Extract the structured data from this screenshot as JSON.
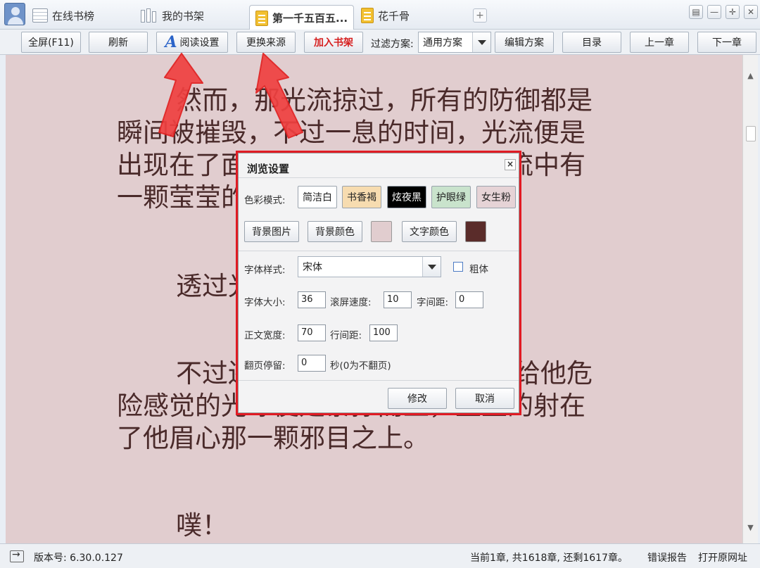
{
  "tabs": [
    {
      "label": "在线书榜",
      "icon": "list-grid-icon"
    },
    {
      "label": "我的书架",
      "icon": "bookshelf-icon"
    },
    {
      "label": "第一千五百五...",
      "icon": "book-icon",
      "active": true
    },
    {
      "label": "花千骨",
      "icon": "book-icon"
    }
  ],
  "tab_add": "+",
  "toolbar": {
    "fullscreen": "全屏(F11)",
    "refresh": "刷新",
    "read_settings": "阅读设置",
    "change_source": "更换来源",
    "add_shelf": "加入书架",
    "filter_label": "过滤方案:",
    "filter_value": "通用方案",
    "edit_scheme": "编辑方案",
    "toc": "目录",
    "prev": "上一章",
    "next": "下一章"
  },
  "content": {
    "paragraphs": [
      "然而，那光流掠过，所有的防御都是瞬间被摧毁，不过一息的时间，光流便是出现在了面前，此时他才看见那光流中有一颗莹莹的光球。",
      "透过光球他能够看见自己那出",
      "不过还没来得及反应，那颗带给他危险感觉的光球便是暴掠而至，重重的射在了他眉心那一颗邪目之上。",
      "噗！"
    ]
  },
  "dialog": {
    "title": "浏览设置",
    "close": "×",
    "color_mode_label": "色彩模式:",
    "color_modes": [
      {
        "label": "简洁白",
        "bg": "#ffffff",
        "fg": "#222222"
      },
      {
        "label": "书香褐",
        "bg": "#f7dcb0",
        "fg": "#222222"
      },
      {
        "label": "炫夜黑",
        "bg": "#000000",
        "fg": "#ffffff"
      },
      {
        "label": "护眼绿",
        "bg": "#c9e3cc",
        "fg": "#222222"
      },
      {
        "label": "女生粉",
        "bg": "#e6d3d6",
        "fg": "#222222"
      }
    ],
    "bg_image": "背景图片",
    "bg_color": "背景颜色",
    "bg_color_value": "#e1cdcf",
    "text_color": "文字颜色",
    "text_color_value": "#5a2c2a",
    "font_style_label": "字体样式:",
    "font_style_value": "宋体",
    "bold_label": "粗体",
    "bold_checked": false,
    "font_size_label": "字体大小:",
    "font_size": "36",
    "scroll_speed_label": "滚屏速度:",
    "scroll_speed": "10",
    "letter_spacing_label": "字间距:",
    "letter_spacing": "0",
    "text_width_label": "正文宽度:",
    "text_width": "70",
    "line_spacing_label": "行间距:",
    "line_spacing": "100",
    "page_stay_label": "翻页停留:",
    "page_stay": "0",
    "page_stay_unit": "秒(0为不翻页)",
    "ok": "修改",
    "cancel": "取消"
  },
  "status": {
    "version": "版本号: 6.30.0.127",
    "chapter_info": "当前1章, 共1618章, 还剩1617章。",
    "report": "错误报告",
    "open_url": "打开原网址"
  },
  "colors": {
    "reader_bg": "#e1cdcf",
    "reader_text": "#4a2a2a",
    "highlight_red": "#e01b24"
  }
}
